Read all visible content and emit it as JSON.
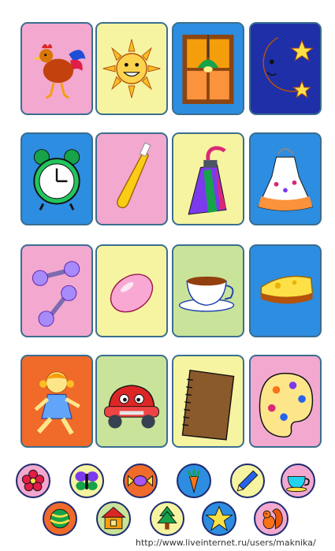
{
  "cards": [
    {
      "name": "rooster",
      "bg": "#f2a8cf"
    },
    {
      "name": "sun",
      "bg": "#f6f4a0"
    },
    {
      "name": "window",
      "bg": "#2d8de0"
    },
    {
      "name": "moon-stars",
      "bg": "#1f2fa8"
    },
    {
      "name": "alarm-clock",
      "bg": "#2d8de0"
    },
    {
      "name": "toothbrush",
      "bg": "#f2a8cf"
    },
    {
      "name": "toothpaste",
      "bg": "#f6f4a0"
    },
    {
      "name": "apron",
      "bg": "#2d8de0"
    },
    {
      "name": "dumbbell",
      "bg": "#f2a8cf"
    },
    {
      "name": "soap",
      "bg": "#f6f4a0"
    },
    {
      "name": "teacup",
      "bg": "#c9e39a"
    },
    {
      "name": "cheese",
      "bg": "#2d8de0"
    },
    {
      "name": "girl",
      "bg": "#f06a2a"
    },
    {
      "name": "car",
      "bg": "#c9e39a"
    },
    {
      "name": "notebook",
      "bg": "#f6f4a0"
    },
    {
      "name": "palette",
      "bg": "#f2a8cf"
    }
  ],
  "tokens": [
    {
      "name": "flower",
      "bg": "#f2a8cf"
    },
    {
      "name": "butterfly",
      "bg": "#f6f4a0"
    },
    {
      "name": "candy",
      "bg": "#f06a2a"
    },
    {
      "name": "carrot",
      "bg": "#2d8de0"
    },
    {
      "name": "pencil",
      "bg": "#f6f4a0"
    },
    {
      "name": "cup",
      "bg": "#f2a8cf"
    },
    {
      "name": "ball",
      "bg": "#f06a2a"
    },
    {
      "name": "house",
      "bg": "#c9e39a"
    },
    {
      "name": "tree",
      "bg": "#f6f4a0"
    },
    {
      "name": "star",
      "bg": "#2d8de0"
    },
    {
      "name": "squirrel",
      "bg": "#f2a8cf"
    }
  ],
  "watermark": "http://www.liveinternet.ru/users/maknika/"
}
